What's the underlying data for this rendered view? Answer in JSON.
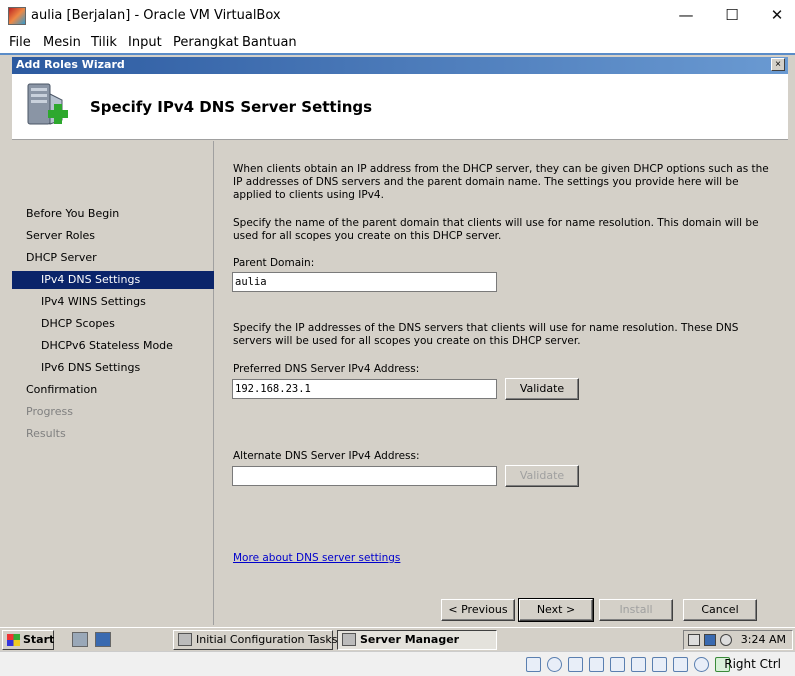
{
  "host_window": {
    "title": "aulia [Berjalan] - Oracle VM VirtualBox",
    "minimize": "—",
    "maximize": "☐",
    "close": "✕",
    "menu": [
      "File",
      "Mesin",
      "Tilik",
      "Input",
      "Perangkat",
      "Bantuan"
    ]
  },
  "wizard": {
    "title": "Add Roles Wizard",
    "close_label": "×",
    "heading": "Specify IPv4 DNS Server Settings",
    "nav": [
      {
        "label": "Before You Begin",
        "state": "normal",
        "indent": false
      },
      {
        "label": "Server Roles",
        "state": "normal",
        "indent": false
      },
      {
        "label": "DHCP Server",
        "state": "normal",
        "indent": false
      },
      {
        "label": "IPv4 DNS Settings",
        "state": "active",
        "indent": true
      },
      {
        "label": "IPv4 WINS Settings",
        "state": "normal",
        "indent": true
      },
      {
        "label": "DHCP Scopes",
        "state": "normal",
        "indent": true
      },
      {
        "label": "DHCPv6 Stateless Mode",
        "state": "normal",
        "indent": true
      },
      {
        "label": "IPv6 DNS Settings",
        "state": "normal",
        "indent": true
      },
      {
        "label": "Confirmation",
        "state": "normal",
        "indent": false
      },
      {
        "label": "Progress",
        "state": "disabled",
        "indent": false
      },
      {
        "label": "Results",
        "state": "disabled",
        "indent": false
      }
    ],
    "intro": "When clients obtain an IP address from the DHCP server, they can be given DHCP options such as the IP addresses of DNS servers and the parent domain name. The settings you provide here will be applied to clients using IPv4.",
    "domain_desc": "Specify the name of the parent domain that clients will use for name resolution. This domain will be used for all scopes you create on this DHCP server.",
    "parent_domain_label": "Parent Domain:",
    "parent_domain_value": "aulia",
    "dns_desc": "Specify the IP addresses of the DNS servers that clients will use for name resolution. These DNS servers will be used for all scopes you create on this DHCP server.",
    "preferred_label": "Preferred DNS Server IPv4 Address:",
    "preferred_value": "192.168.23.1",
    "validate_label": "Validate",
    "alternate_label": "Alternate DNS Server IPv4 Address:",
    "alternate_value": "",
    "validate_alt_label": "Validate",
    "more_link": "More about DNS server settings",
    "buttons": {
      "previous": "< Previous",
      "next": "Next >",
      "install": "Install",
      "cancel": "Cancel"
    }
  },
  "guest_taskbar": {
    "start": "Start",
    "tasks": [
      {
        "label": "Initial Configuration Tasks",
        "pressed": false
      },
      {
        "label": "Server Manager",
        "pressed": true
      }
    ],
    "clock": "3:24 AM"
  },
  "vbox_status": {
    "host_key": "Right Ctrl"
  },
  "colors": {
    "selection": "#0a246a",
    "window_face": "#d4d0c8",
    "link": "#0000cc"
  }
}
